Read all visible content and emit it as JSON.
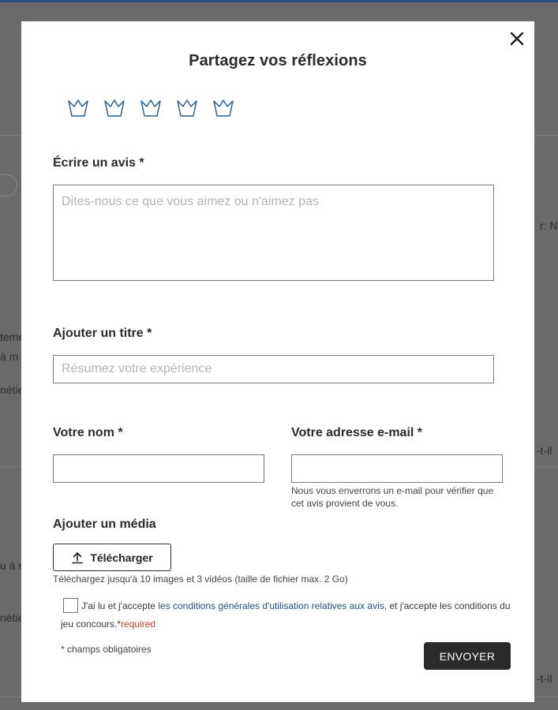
{
  "colors": {
    "accent_star": "#2d5e93",
    "submit_bg": "#2a2a2a",
    "link": "#25507f",
    "required": "#c0392b"
  },
  "background": {
    "fragments": [
      "r: NC",
      "teme",
      "à m",
      "nétie",
      "-t-il",
      "u à m",
      "nétie",
      "-t-il"
    ]
  },
  "modal": {
    "close_icon": "close-icon",
    "title": "Partagez vos réflexions",
    "rating": {
      "max": 5,
      "value": 0,
      "icon": "star-outline-icon"
    },
    "review": {
      "label": "Écrire un avis *",
      "placeholder": "Dites-nous ce que vous aimez ou n'aimez pas",
      "value": ""
    },
    "headline": {
      "label": "Ajouter un titre *",
      "placeholder": "Résumez votre expérience",
      "value": ""
    },
    "name": {
      "label": "Votre nom *",
      "value": ""
    },
    "email": {
      "label": "Votre adresse e-mail *",
      "value": "",
      "hint": "Nous vous enverrons un e-mail pour vérifier que cet avis provient de vous."
    },
    "media": {
      "label": "Ajouter un média",
      "upload_label": "Télécharger",
      "upload_icon": "upload-icon",
      "hint": "Téléchargez jusqu'à 10 images et 3 vidéos (taille de fichier max. 2 Go)"
    },
    "consent": {
      "checked": false,
      "prefix": "J'ai lu et j'accepte",
      "link": "les conditions générales d'utilisation relatives aux avis,",
      "suffix": "et j'accepte les conditions du jeu concours.*",
      "required": "required"
    },
    "required_note": "* champs obligatoires",
    "submit_label": "ENVOYER"
  }
}
